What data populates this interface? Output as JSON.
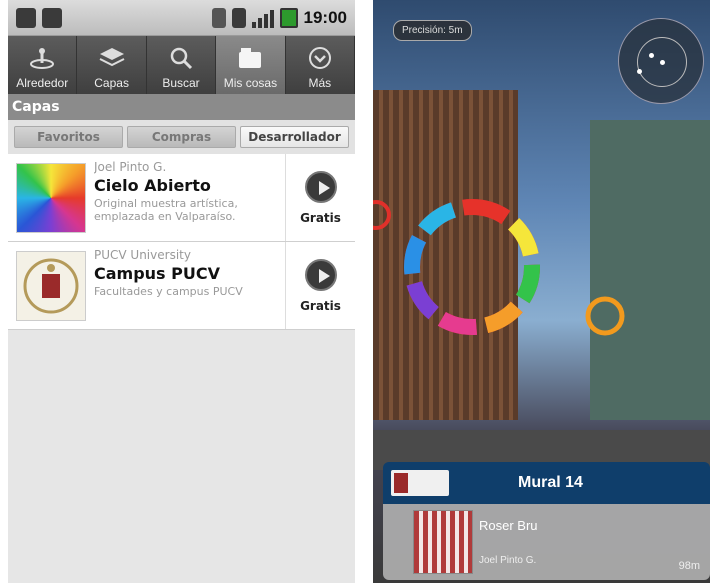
{
  "left": {
    "status": {
      "clock": "19:00"
    },
    "nav_tabs": [
      {
        "label": "Alrededor",
        "icon": "location-icon"
      },
      {
        "label": "Capas",
        "icon": "layers-icon"
      },
      {
        "label": "Buscar",
        "icon": "search-icon"
      },
      {
        "label": "Mis cosas",
        "icon": "folder-icon"
      },
      {
        "label": "Más",
        "icon": "more-icon"
      }
    ],
    "section_title": "Capas",
    "subtabs": [
      "Favoritos",
      "Compras",
      "Desarrollador"
    ],
    "items": [
      {
        "author": "Joel Pinto G.",
        "title": "Cielo Abierto",
        "desc": "Original muestra artística, emplazada en Valparaíso.",
        "price": "Gratis"
      },
      {
        "author": "PUCV University",
        "title": "Campus PUCV",
        "desc": "Facultades y campus PUCV",
        "price": "Gratis"
      }
    ]
  },
  "right": {
    "precision": "Precisión: 5m",
    "card": {
      "title": "Mural 14",
      "name": "Roser Bru",
      "author": "Joel Pinto G.",
      "distance": "98m"
    }
  }
}
